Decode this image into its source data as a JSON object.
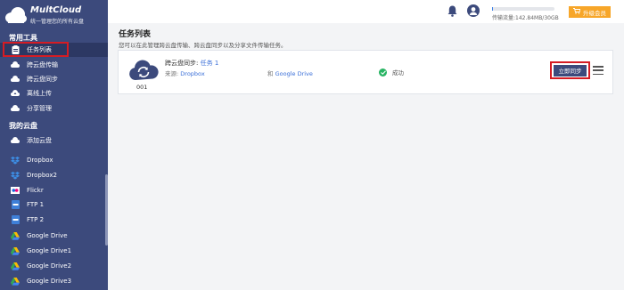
{
  "app": {
    "title": "MultCloud",
    "subtitle": "统一管理您的所有云盘"
  },
  "sidebar": {
    "section_tools": "常用工具",
    "tools": [
      {
        "label": "任务列表",
        "icon": "task-list-icon",
        "active": true
      },
      {
        "label": "跨云盘传输",
        "icon": "cloud-transfer-icon"
      },
      {
        "label": "跨云盘同步",
        "icon": "cloud-sync-icon"
      },
      {
        "label": "离线上传",
        "icon": "upload-icon"
      },
      {
        "label": "分享管理",
        "icon": "share-icon"
      }
    ],
    "section_clouds": "我的云盘",
    "clouds": [
      {
        "label": "添加云盘",
        "icon": "add-cloud-icon"
      },
      {
        "label": "Dropbox",
        "icon": "dropbox-icon"
      },
      {
        "label": "Dropbox2",
        "icon": "dropbox-icon"
      },
      {
        "label": "Flickr",
        "icon": "flickr-icon"
      },
      {
        "label": "FTP 1",
        "icon": "ftp-icon"
      },
      {
        "label": "FTP 2",
        "icon": "ftp-icon"
      },
      {
        "label": "Google Drive",
        "icon": "google-drive-icon"
      },
      {
        "label": "Google Drive1",
        "icon": "google-drive-icon"
      },
      {
        "label": "Google Drive2",
        "icon": "google-drive-icon"
      },
      {
        "label": "Google Drive3",
        "icon": "google-drive-icon"
      }
    ]
  },
  "topbar": {
    "traffic_text": "传输流量:142.84MB/30GB",
    "upgrade_label": "升级会员",
    "traffic_fraction": 0.005,
    "accent": "#f7a629"
  },
  "main": {
    "title": "任务列表",
    "description": "您可以在此管理跨云盘传输、跨云盘同步以及分享文件传输任务。",
    "task": {
      "id": "001",
      "type": "跨云盘同步:",
      "name": "任务 1",
      "source_prefix": "来源:",
      "source": "Dropbox",
      "dest_prefix": "和",
      "dest": "Google Drive",
      "status": "成功",
      "sync_button": "立即同步"
    }
  },
  "colors": {
    "sidebar": "#3c4a7c",
    "highlight": "#d51c24",
    "link": "#3a6fd8",
    "success": "#28b463"
  }
}
